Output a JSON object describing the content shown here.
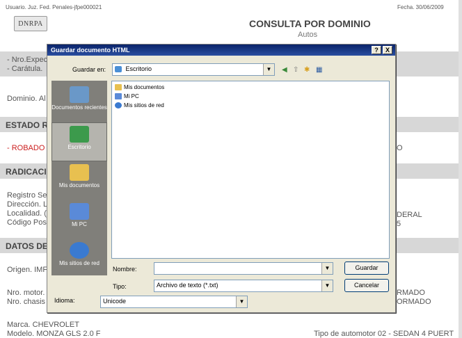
{
  "header": {
    "user_line": "Usuario. Juz. Fed. Penales-jfpe000021",
    "date_line": "Fecha. 30/06/2009",
    "logo_text": "DNRPA",
    "title": "CONSULTA POR DOMINIO",
    "subtitle": "Autos"
  },
  "page": {
    "nro_expediente": "- Nro.Expec",
    "caratula": "- Carátula.",
    "dominio": "Dominio. Al",
    "estado_title": "ESTADO R",
    "robado": "- ROBADO",
    "robado_right": "O",
    "radicacion_title": "RADICACI(",
    "registro": "Registro Se",
    "direccion": "Dirección. L",
    "localidad": "Localidad. (",
    "codigo_postal": "Código Pos",
    "federal_right": "DERAL",
    "cp_right": "5",
    "datos_title": "DATOS DE",
    "origen": "Origen. IMF",
    "nro_motor": "Nro. motor.",
    "nro_chasis": "Nro. chasis",
    "motor_right": "RMADO",
    "chasis_right": "ORMADO",
    "marca": "Marca. CHEVROLET",
    "modelo": "Modelo. MONZA GLS 2.0 F",
    "tipo_automotor": "Tipo de automotor 02 - SEDAN 4 PUERT"
  },
  "dialog": {
    "title": "Guardar documento HTML",
    "help_btn": "?",
    "close_btn": "X",
    "save_in_label": "Guardar en:",
    "save_in_value": "Escritorio",
    "places": [
      {
        "label": "Documentos recientes"
      },
      {
        "label": "Escritorio"
      },
      {
        "label": "Mis documentos"
      },
      {
        "label": "Mi PC"
      },
      {
        "label": "Mis sitios de red"
      }
    ],
    "files": [
      {
        "name": "Mis documentos"
      },
      {
        "name": "Mi PC"
      },
      {
        "name": "Mis sitios de red"
      }
    ],
    "name_label": "Nombre:",
    "name_value": "",
    "type_label": "Tipo:",
    "type_value": "Archivo de texto (*.txt)",
    "lang_label": "Idioma:",
    "lang_value": "Unicode",
    "save_button": "Guardar",
    "cancel_button": "Cancelar"
  }
}
